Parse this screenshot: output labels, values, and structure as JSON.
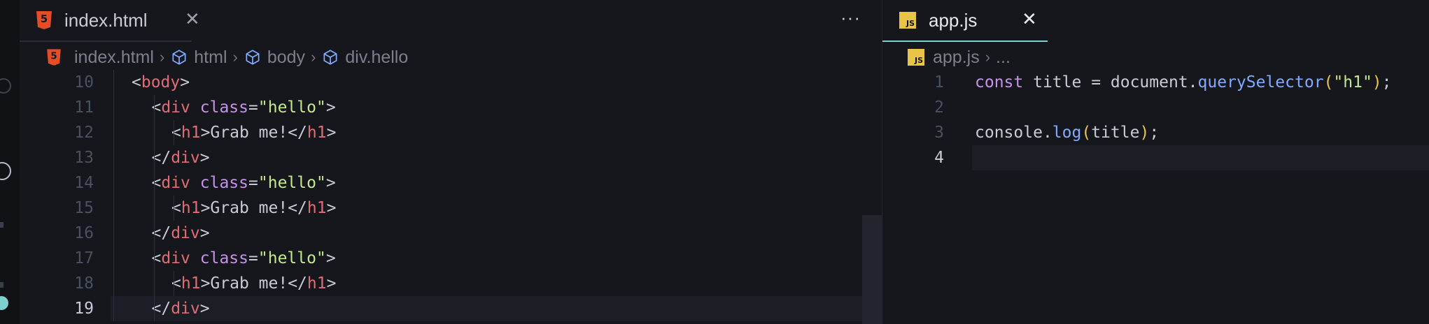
{
  "left_editor": {
    "tab": {
      "label": "index.html",
      "icon": "html5-icon"
    },
    "more_label": "···",
    "breadcrumb": [
      {
        "label": "index.html",
        "icon": "html5-icon"
      },
      {
        "label": "html",
        "icon": "cube-icon"
      },
      {
        "label": "body",
        "icon": "cube-icon"
      },
      {
        "label": "div.hello",
        "icon": "cube-icon"
      }
    ],
    "lines": [
      {
        "num": "10",
        "tokens": [
          [
            "t-punct",
            "<"
          ],
          [
            "t-tag",
            "body"
          ],
          [
            "t-punct",
            ">"
          ]
        ]
      },
      {
        "num": "11",
        "tokens": [
          [
            "t-punct",
            "<"
          ],
          [
            "t-tag",
            "div"
          ],
          [
            "t-punct",
            " "
          ],
          [
            "t-attr",
            "class"
          ],
          [
            "t-punct",
            "="
          ],
          [
            "t-str",
            "\"hello\""
          ],
          [
            "t-punct",
            ">"
          ]
        ]
      },
      {
        "num": "12",
        "tokens": [
          [
            "t-punct",
            "<"
          ],
          [
            "t-tag",
            "h1"
          ],
          [
            "t-punct",
            ">"
          ],
          [
            "t-text",
            "Grab me!"
          ],
          [
            "t-punct",
            "</"
          ],
          [
            "t-tag",
            "h1"
          ],
          [
            "t-punct",
            ">"
          ]
        ]
      },
      {
        "num": "13",
        "tokens": [
          [
            "t-punct",
            "</"
          ],
          [
            "t-tag",
            "div"
          ],
          [
            "t-punct",
            ">"
          ]
        ]
      },
      {
        "num": "14",
        "tokens": [
          [
            "t-punct",
            "<"
          ],
          [
            "t-tag",
            "div"
          ],
          [
            "t-punct",
            " "
          ],
          [
            "t-attr",
            "class"
          ],
          [
            "t-punct",
            "="
          ],
          [
            "t-str",
            "\"hello\""
          ],
          [
            "t-punct",
            ">"
          ]
        ]
      },
      {
        "num": "15",
        "tokens": [
          [
            "t-punct",
            "<"
          ],
          [
            "t-tag",
            "h1"
          ],
          [
            "t-punct",
            ">"
          ],
          [
            "t-text",
            "Grab me!"
          ],
          [
            "t-punct",
            "</"
          ],
          [
            "t-tag",
            "h1"
          ],
          [
            "t-punct",
            ">"
          ]
        ]
      },
      {
        "num": "16",
        "tokens": [
          [
            "t-punct",
            "</"
          ],
          [
            "t-tag",
            "div"
          ],
          [
            "t-punct",
            ">"
          ]
        ]
      },
      {
        "num": "17",
        "tokens": [
          [
            "t-punct",
            "<"
          ],
          [
            "t-tag",
            "div"
          ],
          [
            "t-punct",
            " "
          ],
          [
            "t-attr",
            "class"
          ],
          [
            "t-punct",
            "="
          ],
          [
            "t-str",
            "\"hello\""
          ],
          [
            "t-punct",
            ">"
          ]
        ]
      },
      {
        "num": "18",
        "tokens": [
          [
            "t-punct",
            "<"
          ],
          [
            "t-tag",
            "h1"
          ],
          [
            "t-punct",
            ">"
          ],
          [
            "t-text",
            "Grab me!"
          ],
          [
            "t-punct",
            "</"
          ],
          [
            "t-tag",
            "h1"
          ],
          [
            "t-punct",
            ">"
          ]
        ]
      },
      {
        "num": "19",
        "tokens": [
          [
            "t-punct",
            "</"
          ],
          [
            "t-tag",
            "div"
          ],
          [
            "t-punct",
            ">"
          ]
        ],
        "current": true
      }
    ]
  },
  "right_editor": {
    "tab": {
      "label": "app.js",
      "icon": "js-icon"
    },
    "breadcrumb": [
      {
        "label": "app.js",
        "icon": "js-icon"
      },
      {
        "label": "...",
        "icon": ""
      }
    ],
    "lines": [
      {
        "num": "1",
        "tokens": [
          [
            "t-kw",
            "const"
          ],
          [
            "t-var",
            " title "
          ],
          [
            "t-punct",
            "="
          ],
          [
            "t-var",
            " document"
          ],
          [
            "t-punct",
            "."
          ],
          [
            "t-fn",
            "querySelector"
          ],
          [
            "t-paren",
            "("
          ],
          [
            "t-str",
            "\"h1\""
          ],
          [
            "t-paren",
            ")"
          ],
          [
            "t-punct",
            ";"
          ]
        ]
      },
      {
        "num": "2",
        "tokens": []
      },
      {
        "num": "3",
        "tokens": [
          [
            "t-var",
            "console"
          ],
          [
            "t-punct",
            "."
          ],
          [
            "t-fn",
            "log"
          ],
          [
            "t-paren",
            "("
          ],
          [
            "t-var",
            "title"
          ],
          [
            "t-paren",
            ")"
          ],
          [
            "t-punct",
            ";"
          ]
        ]
      },
      {
        "num": "4",
        "tokens": [],
        "current": true
      }
    ]
  },
  "colors": {
    "tab_underline_left": "#2a2d35",
    "tab_underline_right": "#7ecfcf",
    "html_icon": "#e44d26",
    "js_icon": "#e8c547",
    "active_line": "#1b1e25"
  }
}
